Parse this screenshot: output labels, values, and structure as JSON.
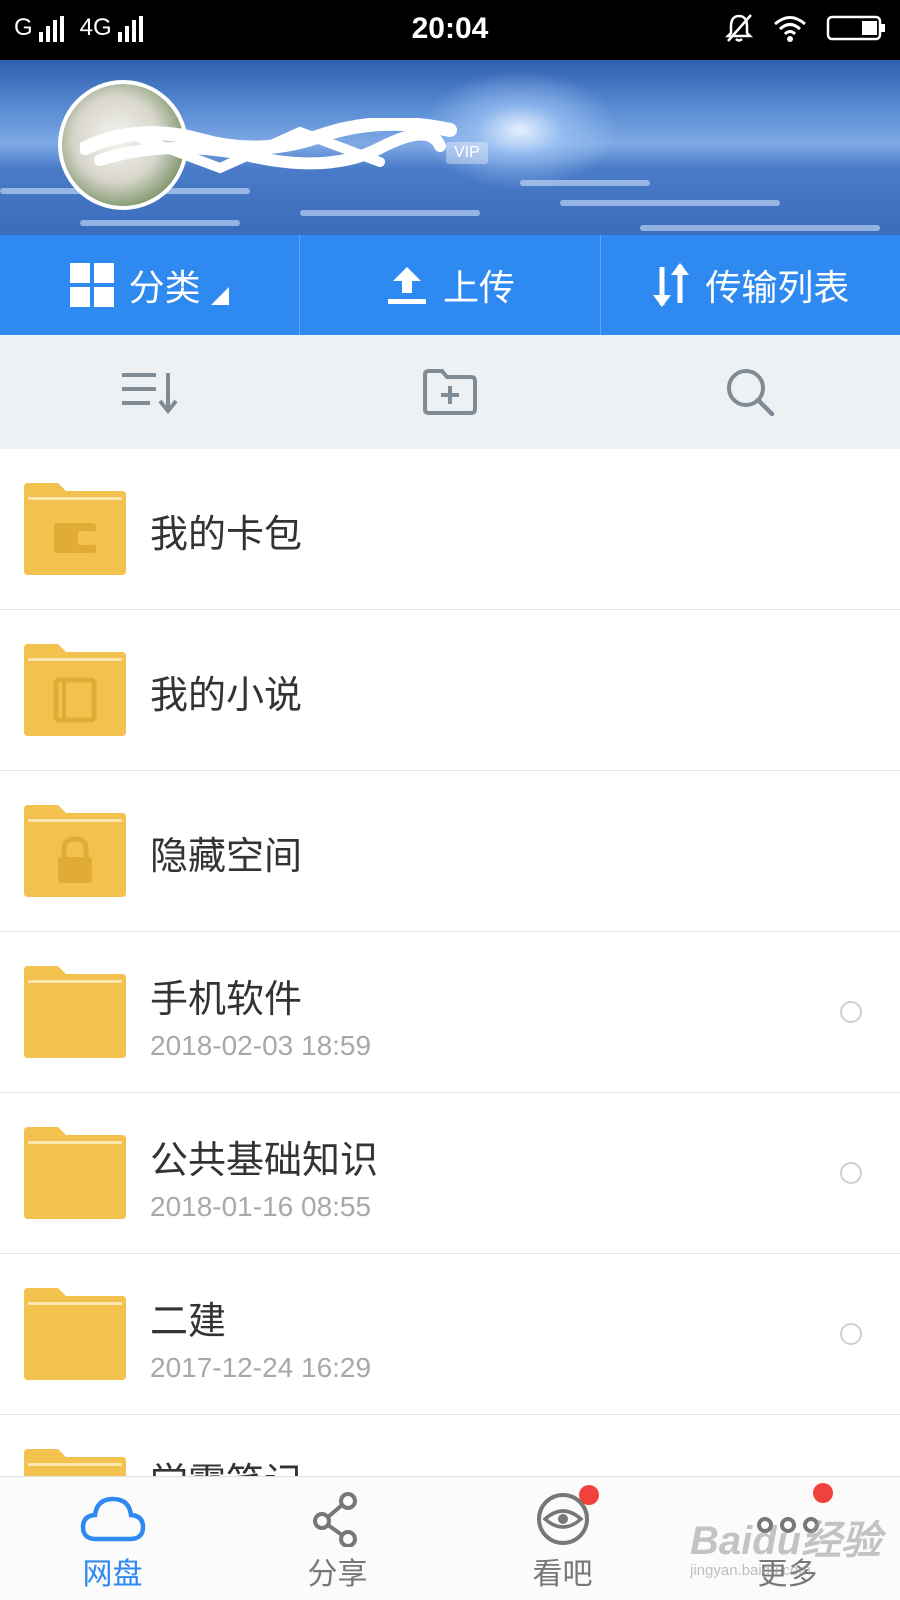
{
  "status_bar": {
    "carrier_1": "G",
    "carrier_2": "4G",
    "time": "20:04",
    "icons": [
      "signal-icon",
      "mute-notification-icon",
      "wifi-icon",
      "battery-icon"
    ]
  },
  "header": {
    "vip_badge": "VIP",
    "avatar": "avatar"
  },
  "action_bar": {
    "category_label": "分类",
    "upload_label": "上传",
    "transfer_label": "传输列表"
  },
  "toolbar": {
    "icons": [
      "sort-icon",
      "new-folder-icon",
      "search-icon"
    ]
  },
  "files": [
    {
      "name": "我的卡包",
      "date": "",
      "icon": "wallet-folder-icon"
    },
    {
      "name": "我的小说",
      "date": "",
      "icon": "book-folder-icon"
    },
    {
      "name": "隐藏空间",
      "date": "",
      "icon": "lock-folder-icon"
    },
    {
      "name": "手机软件",
      "date": "2018-02-03  18:59",
      "icon": "folder-icon"
    },
    {
      "name": "公共基础知识",
      "date": "2018-01-16  08:55",
      "icon": "folder-icon"
    },
    {
      "name": "二建",
      "date": "2017-12-24  16:29",
      "icon": "folder-icon"
    },
    {
      "name": "学霸笔记",
      "date": "",
      "icon": "folder-icon"
    }
  ],
  "bottom_nav": {
    "items": [
      {
        "label": "网盘",
        "icon": "cloud-icon",
        "active": true
      },
      {
        "label": "分享",
        "icon": "share-icon",
        "active": false
      },
      {
        "label": "看吧",
        "icon": "eye-icon",
        "active": false
      },
      {
        "label": "更多",
        "icon": "more-icon",
        "active": false
      }
    ]
  },
  "watermark": {
    "text": "Baidu经验",
    "url": "jingyan.baidu.com"
  },
  "colors": {
    "accent": "#2e8af0",
    "folder": "#f2c14e",
    "badge": "#f0413d"
  }
}
